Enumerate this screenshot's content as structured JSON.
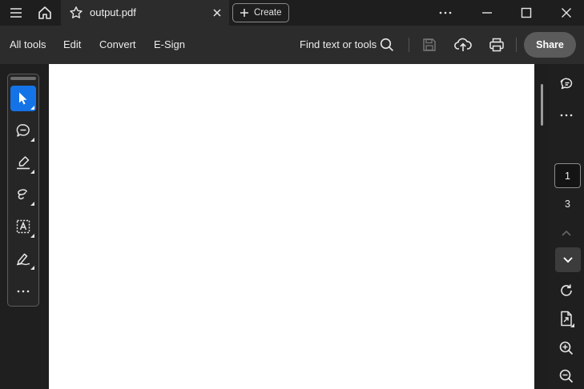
{
  "window": {
    "tab_title": "output.pdf",
    "create_label": "Create"
  },
  "toolbar": {
    "menu": [
      "All tools",
      "Edit",
      "Convert",
      "E-Sign"
    ],
    "search_label": "Find text or tools",
    "share_label": "Share"
  },
  "navigation": {
    "current_page": "1",
    "total_pages": "3"
  },
  "icons": {
    "titlebar": [
      "menu-icon",
      "home-icon",
      "star-icon",
      "close-tab-icon",
      "plus-icon",
      "more-icon",
      "minimize-icon",
      "maximize-icon",
      "close-window-icon"
    ],
    "toolbar": [
      "search-icon",
      "save-icon",
      "cloud-upload-icon",
      "print-icon"
    ],
    "left_rail": [
      "select-cursor-icon",
      "comment-icon",
      "highlight-icon",
      "draw-freehand-icon",
      "text-select-icon",
      "sign-pen-icon",
      "more-tools-icon"
    ],
    "right_rail": [
      "comments-panel-icon",
      "more-options-icon",
      "chevron-up-icon",
      "chevron-down-icon",
      "rotate-icon",
      "page-extract-icon",
      "zoom-in-icon",
      "zoom-out-icon"
    ]
  },
  "colors": {
    "accent": "#1473e6",
    "titlebar": "#1e1e1e",
    "toolbar": "#2c2c2c",
    "share_button": "#5b5b5b",
    "page": "#ffffff"
  }
}
